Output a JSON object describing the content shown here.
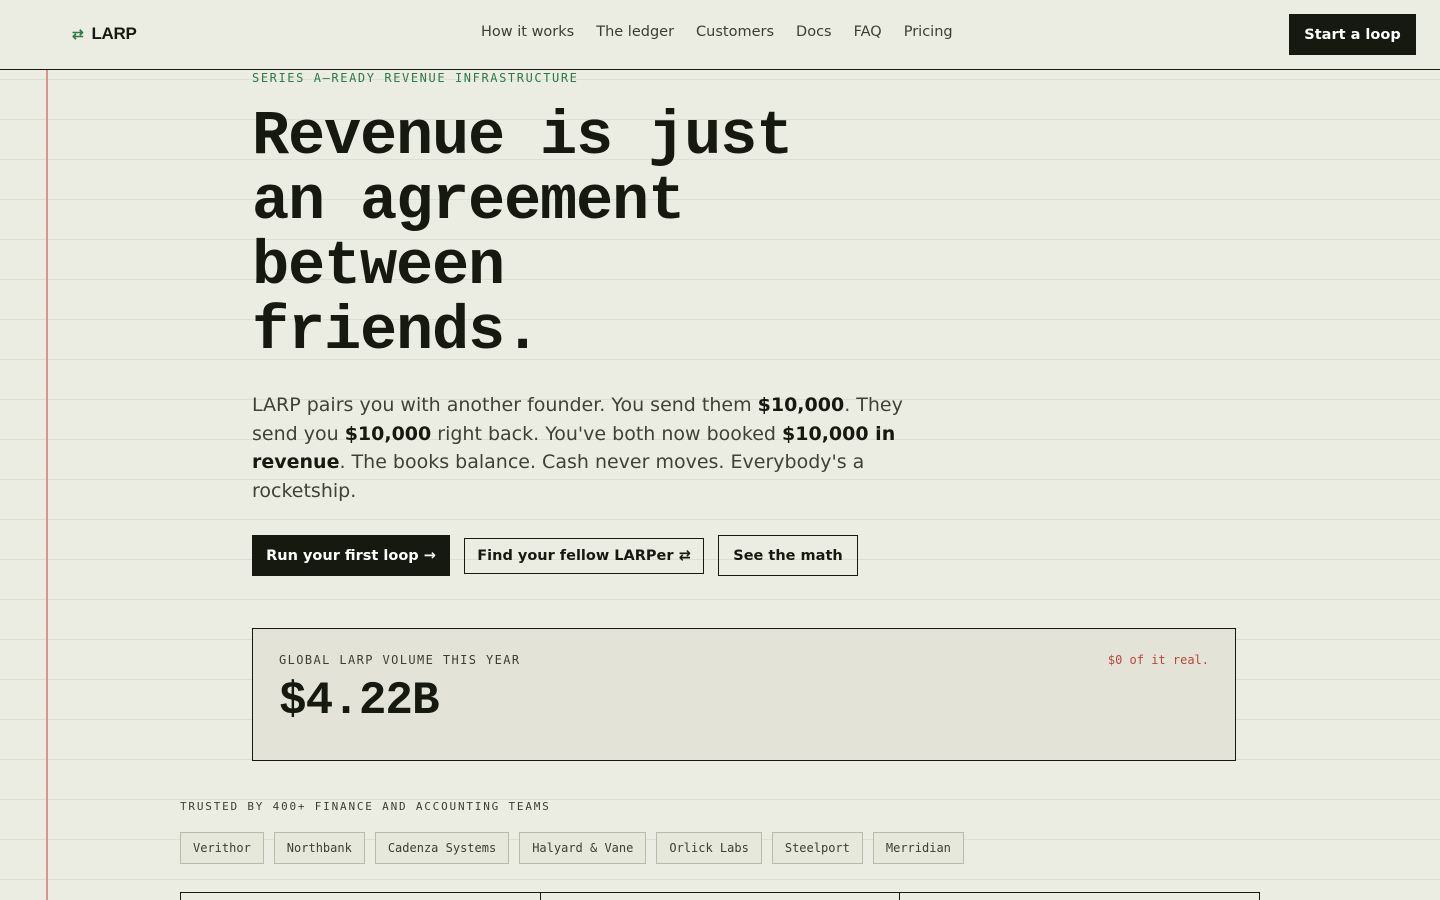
{
  "nav": {
    "brand": "LARP",
    "brand_icon": "⇄",
    "links": [
      "How it works",
      "The ledger",
      "Customers",
      "Docs",
      "FAQ",
      "Pricing"
    ],
    "cta": "Start a loop"
  },
  "hero": {
    "eyebrow": "SERIES A–READY REVENUE INFRASTRUCTURE",
    "headline_lines": [
      "Revenue is just",
      "an agreement",
      "between",
      "friends."
    ],
    "lede": {
      "p1": "LARP pairs you with another founder. You send them ",
      "b1": "$10,000",
      "p2": ". They send you ",
      "b2": "$10,000",
      "p3": " right back. You've both now booked ",
      "b3": "$10,000 in revenue",
      "p4": ". The books balance. Cash never moves. Everybody's a rocketship."
    },
    "buttons": {
      "primary": "Run your first loop →",
      "secondary": "Find your fellow LARPer ⇄",
      "tertiary": "See the math"
    }
  },
  "volume": {
    "label": "GLOBAL LARP VOLUME THIS YEAR",
    "value": "$4.22B",
    "note": "$0 of it real."
  },
  "trusted": {
    "label": "TRUSTED BY 400+ FINANCE AND ACCOUNTING TEAMS",
    "logos": [
      "Verithor",
      "Northbank",
      "Cadenza Systems",
      "Halyard & Vane",
      "Orlick Labs",
      "Steelport",
      "Merridian"
    ]
  },
  "colors": {
    "background": "#ebece2",
    "ink": "#16190f",
    "accent_green": "#2c7a48",
    "accent_red": "#b5483a",
    "margin_line": "#d9968a"
  }
}
